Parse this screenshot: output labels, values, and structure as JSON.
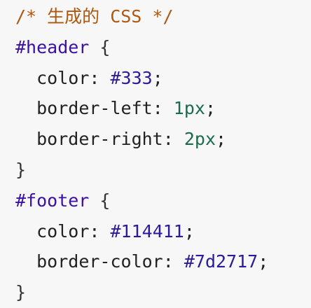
{
  "code": {
    "comment": "/* 生成的 CSS */",
    "rules": [
      {
        "selector": "#header",
        "decls": [
          {
            "prop": "color",
            "value": "#333",
            "kind": "hex"
          },
          {
            "prop": "border-left",
            "value": "1px",
            "kind": "num"
          },
          {
            "prop": "border-right",
            "value": "2px",
            "kind": "num"
          }
        ]
      },
      {
        "selector": "#footer",
        "decls": [
          {
            "prop": "color",
            "value": "#114411",
            "kind": "hex"
          },
          {
            "prop": "border-color",
            "value": "#7d2717",
            "kind": "hex"
          }
        ]
      }
    ]
  },
  "colors": {
    "comment": "#b0570f",
    "selector": "#3b10a8",
    "hex": "#2c1a9c",
    "number": "#1b6b4e",
    "background": "#f7f7f7"
  }
}
